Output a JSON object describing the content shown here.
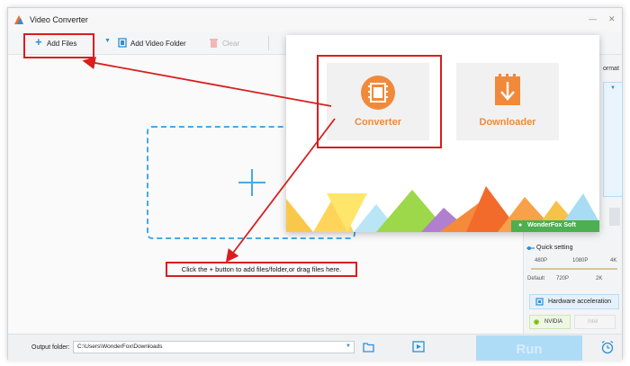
{
  "window": {
    "title": "Video Converter",
    "controls": {
      "minimize": "—",
      "close": "✕"
    }
  },
  "toolbar": {
    "add_files": "Add Files",
    "add_video_folder": "Add Video Folder",
    "clear": "Clear"
  },
  "dropzone": {
    "hint": "Click the + button to add files/folder,or drag files here."
  },
  "popup": {
    "converter_label": "Converter",
    "downloader_label": "Downloader",
    "brand": "WonderFox Soft"
  },
  "right_panel": {
    "format_label": "ormat",
    "quick_setting": "Quick setting",
    "scale_top": [
      "480P",
      "1080P",
      "4K"
    ],
    "scale_bottom": [
      "Default",
      "720P",
      "2K"
    ],
    "hardware_acceleration": "Hardware acceleration",
    "nvidia": "NVIDIA",
    "intel": "Intel"
  },
  "bottom": {
    "output_folder_label": "Output folder:",
    "output_folder_value": "C:\\Users\\WonderFox\\Downloads",
    "run_label": "Run"
  },
  "colors": {
    "accent_blue": "#2a8fd8",
    "annotation_red": "#d81e1e",
    "brand_orange": "#f08a3a",
    "run_button": "#aedcf7"
  }
}
